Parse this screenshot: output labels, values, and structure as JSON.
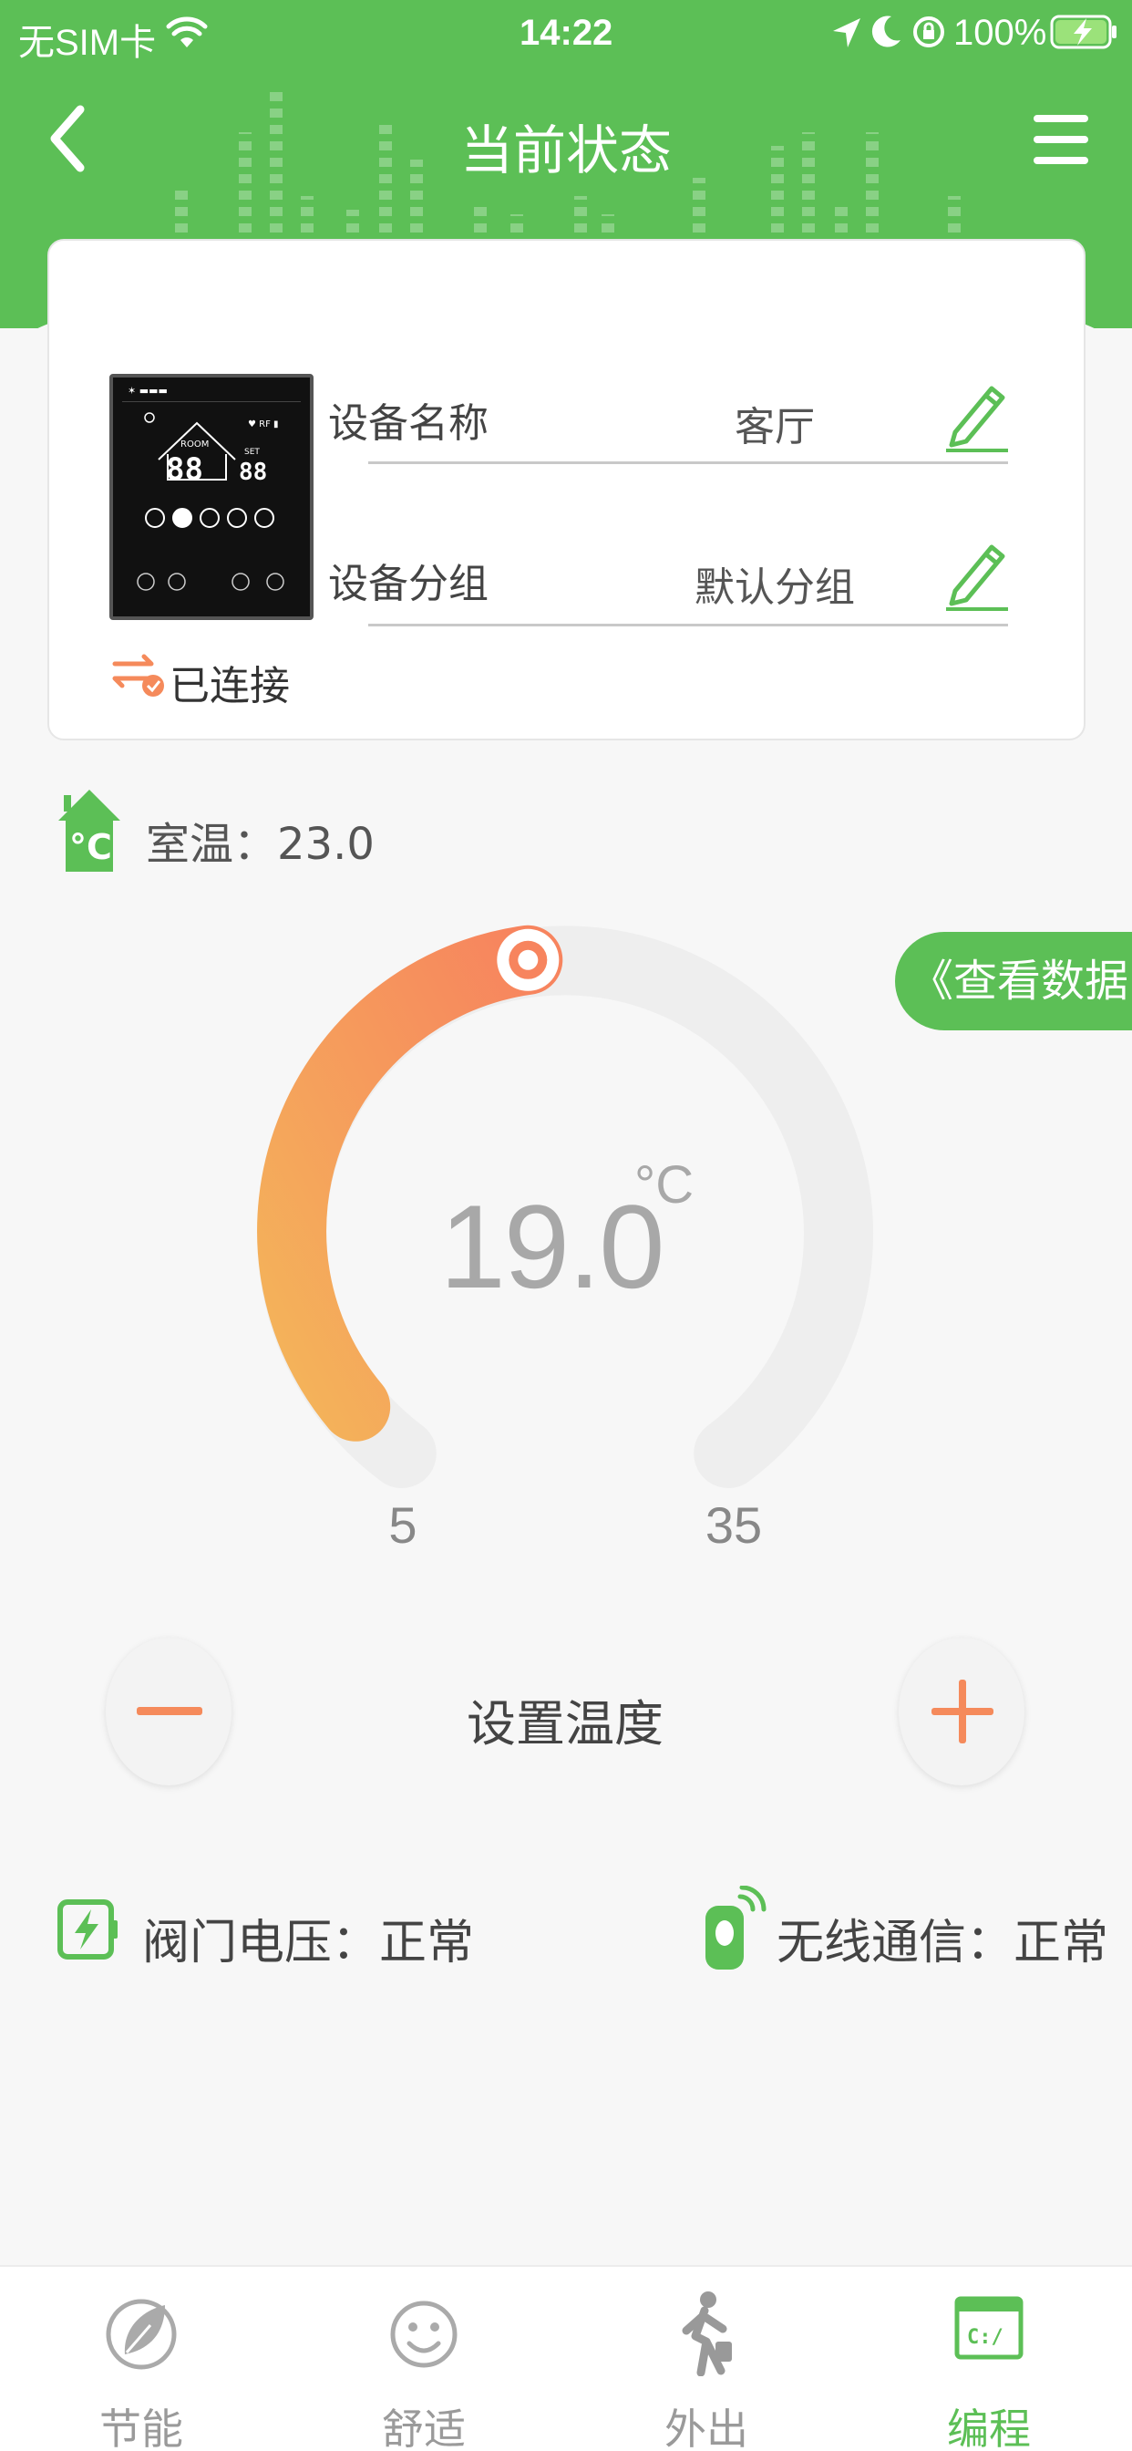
{
  "status_bar": {
    "carrier": "无SIM卡",
    "time": "14:22",
    "battery": "100%"
  },
  "header": {
    "title": "当前状态"
  },
  "device": {
    "name_label": "设备名称",
    "name_value": "客厅",
    "group_label": "设备分组",
    "group_value": "默认分组",
    "connection_status": "已连接"
  },
  "room": {
    "label": "室温：23.0"
  },
  "view_data_button": "《查看数据",
  "gauge": {
    "value": "19.0",
    "unit": "°C",
    "min_label": "5",
    "max_label": "35",
    "progress": 0.47
  },
  "controls": {
    "set_temp_label": "设置温度"
  },
  "status": {
    "valve_voltage": "阀门电压：正常",
    "wireless": "无线通信：正常"
  },
  "tabs": [
    {
      "label": "节能",
      "icon": "leaf-icon"
    },
    {
      "label": "舒适",
      "icon": "smile-icon"
    },
    {
      "label": "外出",
      "icon": "walking-person-icon"
    },
    {
      "label": "编程",
      "icon": "terminal-window-icon"
    }
  ],
  "active_tab": "编程",
  "colors": {
    "brand_green": "#5cbf56",
    "accent_orange": "#f58a5b",
    "gauge_gradient_start": "#f4b45a",
    "gauge_gradient_end": "#f7845e"
  }
}
